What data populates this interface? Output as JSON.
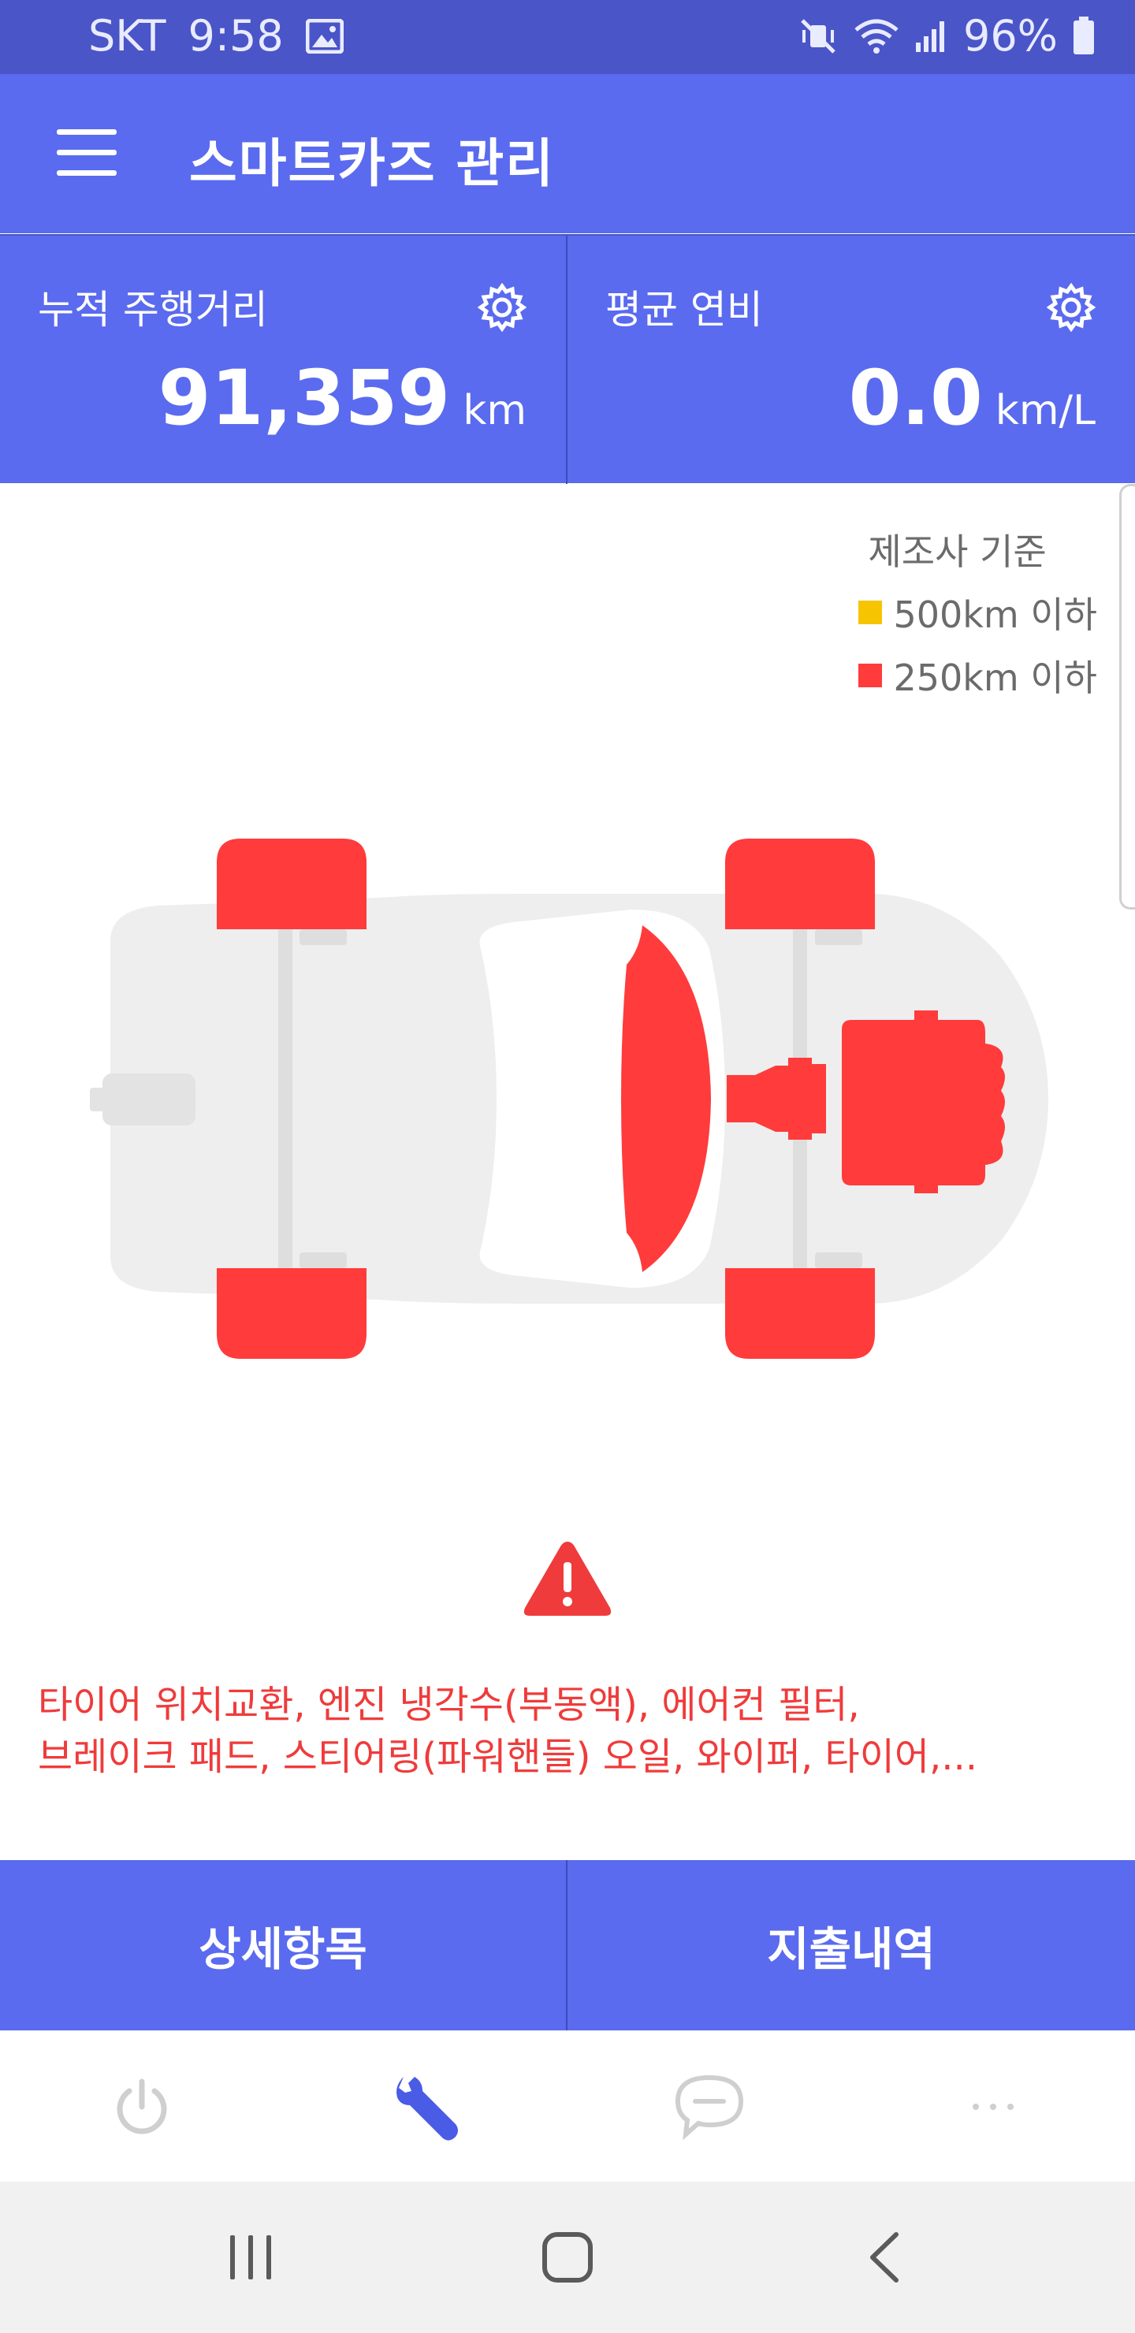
{
  "status_bar": {
    "carrier": "SKT",
    "time": "9:58",
    "battery": "96%"
  },
  "app": {
    "title": "스마트카즈 관리"
  },
  "stats": {
    "mileage": {
      "label": "누적 주행거리",
      "value": "91,359",
      "unit": "km"
    },
    "fuel_efficiency": {
      "label": "평균 연비",
      "value": "0.0",
      "unit": "km/L"
    }
  },
  "legend": {
    "title": "제조사 기준",
    "items": [
      {
        "label": "500km 이하",
        "color": "#f6c400"
      },
      {
        "label": "250km 이하",
        "color": "#ff3b3b"
      }
    ]
  },
  "warning": {
    "line1": "타이어 위치교환, 엔진 냉각수(부동액), 에어컨 필터,",
    "line2": "브레이크 패드, 스티어링(파워핸들) 오일, 와이퍼, 타이어,..."
  },
  "actions": {
    "details": "상세항목",
    "expenses": "지출내역"
  },
  "bottom_nav": {
    "items": [
      {
        "icon": "power-icon",
        "active": false
      },
      {
        "icon": "wrench-icon",
        "active": true
      },
      {
        "icon": "chat-icon",
        "active": false
      },
      {
        "icon": "more-icon",
        "active": false
      }
    ]
  },
  "colors": {
    "primary": "#5a6bef",
    "status_bar": "#4a55c8",
    "alert_red": "#ff3b3b",
    "car_body": "#eeeeee"
  }
}
